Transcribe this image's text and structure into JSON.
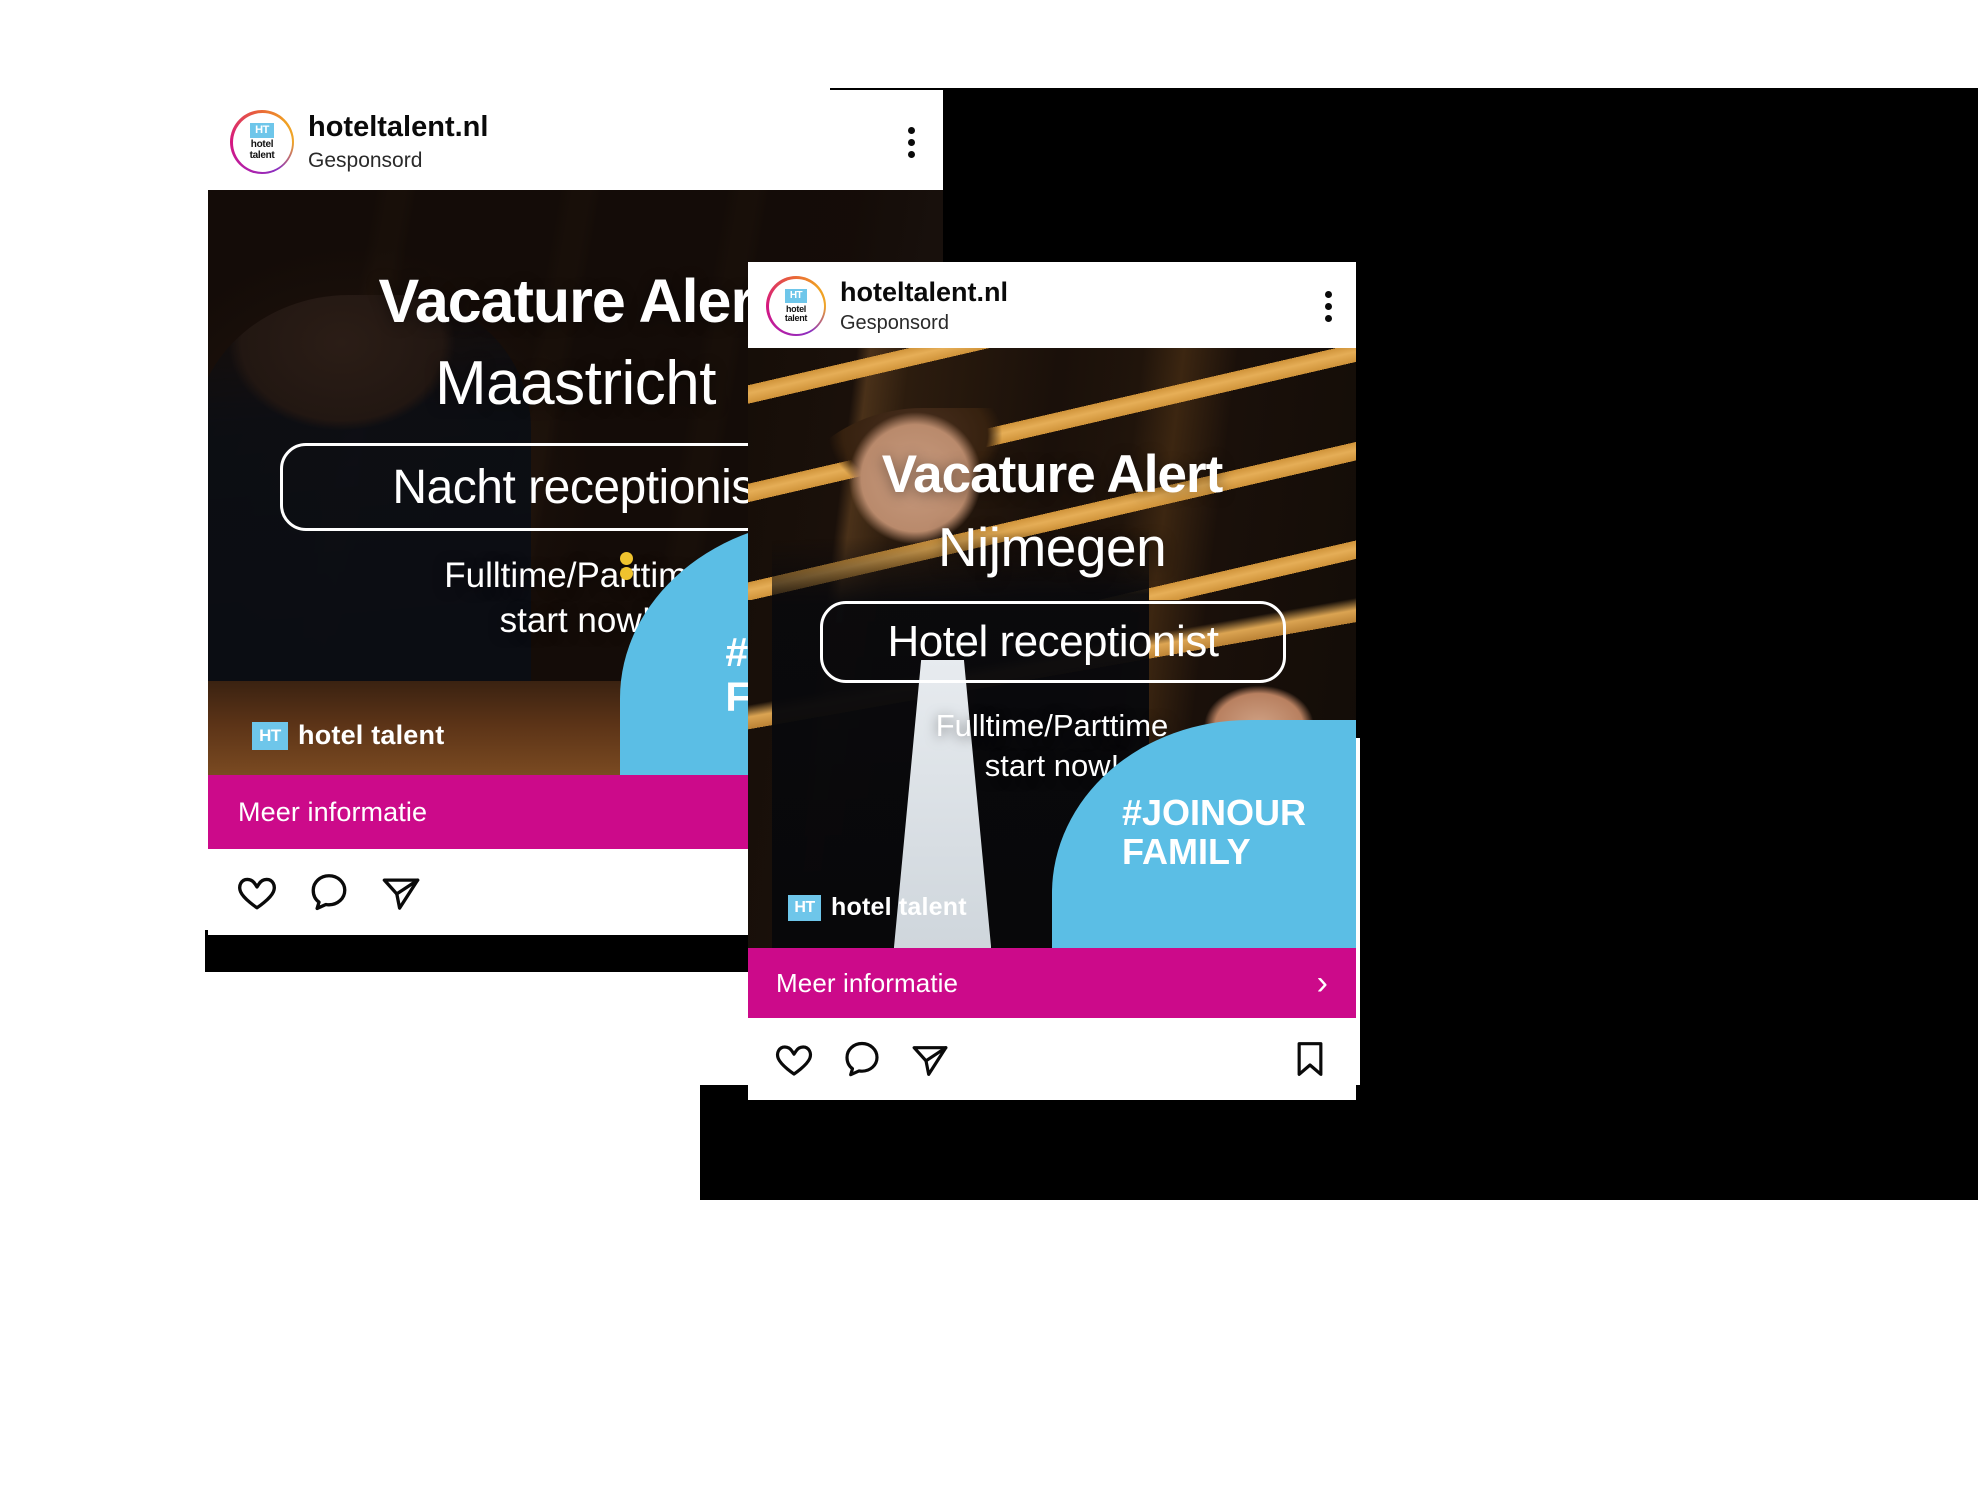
{
  "page": {
    "background_color": "#ffffff",
    "shadow_color": "#000000"
  },
  "brand": {
    "accent_pink": "#cc0a8a",
    "accent_blue": "#5bbee5",
    "logo_blue": "#6ec6ea",
    "accent_yellow": "#f0c32e",
    "logo_mark_text": "HT",
    "logo_word_line1": "hotel",
    "logo_word_line2": "talent",
    "watermark_text": "hotel talent"
  },
  "posts": [
    {
      "id": "back",
      "header": {
        "handle": "hoteltalent.nl",
        "sponsored_label": "Gesponsord",
        "avatar_name": "avatar",
        "menu_name": "more-options-icon"
      },
      "creative": {
        "headline": "Vacature Alert",
        "city": "Maastricht",
        "role": "Nacht receptionist",
        "terms_line1": "Fulltime/Parttime",
        "terms_line2": "start now!",
        "blob_line1": "#JOINOUR",
        "blob_line2": "FAMILY",
        "watermark": "hotel talent"
      },
      "cta": {
        "label": "Meer informatie",
        "chevron": "›",
        "show_chevron": false
      },
      "actions": {
        "like": "like-icon",
        "comment": "comment-icon",
        "share": "share-icon",
        "save": "save-icon",
        "show_save": false
      }
    },
    {
      "id": "front",
      "header": {
        "handle": "hoteltalent.nl",
        "sponsored_label": "Gesponsord",
        "avatar_name": "avatar",
        "menu_name": "more-options-icon"
      },
      "creative": {
        "headline": "Vacature Alert",
        "city": "Nijmegen",
        "role": "Hotel receptionist",
        "terms_line1": "Fulltime/Parttime",
        "terms_line2": "start now!",
        "blob_line1": "#JOINOUR",
        "blob_line2": "FAMILY",
        "watermark": "hotel talent"
      },
      "cta": {
        "label": "Meer informatie",
        "chevron": "›",
        "show_chevron": true
      },
      "actions": {
        "like": "like-icon",
        "comment": "comment-icon",
        "share": "share-icon",
        "save": "save-icon",
        "show_save": true
      }
    }
  ]
}
